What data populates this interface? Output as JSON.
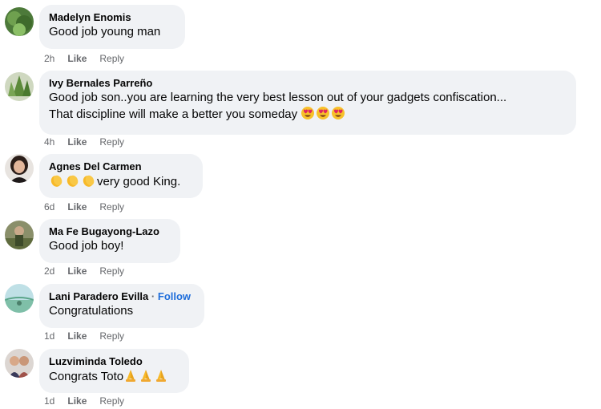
{
  "comments": [
    {
      "author": "Madelyn Enomis",
      "text": "Good job young man",
      "time": "2h",
      "like": "Like",
      "reply": "Reply"
    },
    {
      "author": "Ivy Bernales Parreño",
      "text_line1": "Good job son..you are learning the very best lesson out of your gadgets confiscation...",
      "text_line2": "That discipline will make a better you someday",
      "emoji": "heart-eyes-emoji",
      "time": "4h",
      "like": "Like",
      "reply": "Reply"
    },
    {
      "author": "Agnes Del Carmen",
      "text": "very good King.",
      "emoji": "clapping-hands-emoji",
      "time": "6d",
      "like": "Like",
      "reply": "Reply"
    },
    {
      "author": "Ma Fe Bugayong-Lazo",
      "text": "Good job boy!",
      "time": "2d",
      "like": "Like",
      "reply": "Reply"
    },
    {
      "author": "Lani Paradero Evilla",
      "separator": "·",
      "follow": "Follow",
      "text": "Congratulations",
      "time": "1d",
      "like": "Like",
      "reply": "Reply"
    },
    {
      "author": "Luzviminda Toledo",
      "text": "Congrats Toto",
      "emoji": "folded-hands-emoji",
      "time": "1d",
      "like": "Like",
      "reply": "Reply"
    }
  ],
  "colors": {
    "bubble": "#f0f2f5",
    "meta": "#65676b",
    "follow": "#216fdb",
    "text": "#050505"
  }
}
